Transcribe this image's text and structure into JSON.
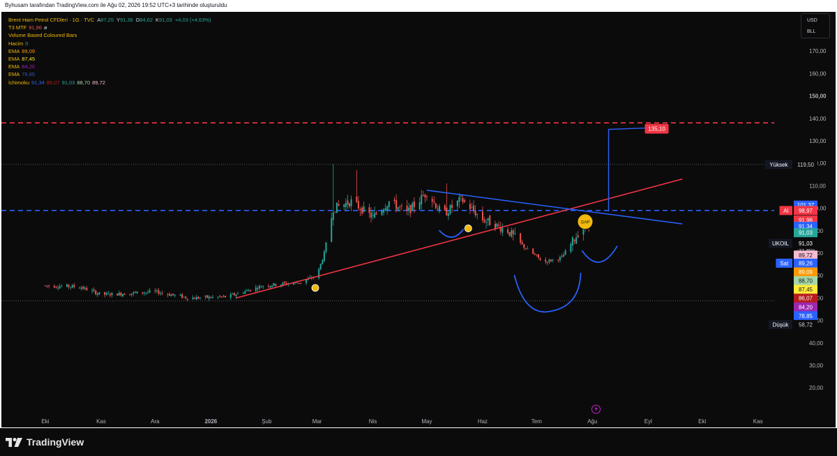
{
  "header": {
    "text": "Byhusam tarafından TradingView.com ile Ağu 02, 2026 19:52 UTC+3 tarihinde oluşturuldu"
  },
  "legend": {
    "title": "Brent Ham Petrol CFDleri · 1G · TVC",
    "ohlc": [
      {
        "key": "A",
        "value": "87,25"
      },
      {
        "key": "Y",
        "value": "91,36"
      },
      {
        "key": "D",
        "value": "84,62"
      },
      {
        "key": "K",
        "value": "91,03"
      }
    ],
    "change": "+4,03 (+4,63%)",
    "indicators": [
      {
        "name": "T3 MTF",
        "values": [
          "91,96",
          "ø"
        ],
        "colors": [
          "#ef5350",
          "#d1d4dc"
        ]
      },
      {
        "name": "Volume Based Coloured Bars",
        "values": [],
        "colors": []
      },
      {
        "name": "Hacim",
        "values": [
          "0"
        ],
        "colors": [
          "#26a69a"
        ]
      },
      {
        "name": "EMA",
        "values": [
          "89,09"
        ],
        "colors": [
          "#ff9800"
        ]
      },
      {
        "name": "EMA",
        "values": [
          "87,45"
        ],
        "colors": [
          "#ffeb3b"
        ]
      },
      {
        "name": "EMA",
        "values": [
          "84,20"
        ],
        "colors": [
          "#9c27b0"
        ]
      },
      {
        "name": "EMA",
        "values": [
          "78,85"
        ],
        "colors": [
          "#3f51b5"
        ]
      },
      {
        "name": "İchimoku",
        "values": [
          "91,34",
          "86,07",
          "91,03",
          "88,70",
          "89,72"
        ],
        "colors": [
          "#2962ff",
          "#b71c1c",
          "#26a69a",
          "#a5d6a7",
          "#f8bbd0"
        ]
      }
    ]
  },
  "currency": {
    "top": "USD",
    "bottom": "BLL"
  },
  "branding": {
    "logo": "TradingView"
  },
  "colors": {
    "background": "#0b0b0b",
    "up": "#26a69a",
    "down": "#ef5350",
    "support": "#f23645",
    "resistance": "#2962ff",
    "pattern": "#2962ff"
  },
  "chart_data": {
    "type": "candlestick",
    "symbol": "UKOIL",
    "timeframe": "1G",
    "y_axis_ticks": [
      20,
      30,
      40,
      50,
      60,
      70,
      80,
      90,
      100,
      110,
      120,
      130,
      140,
      150,
      160,
      170
    ],
    "y_tick_labels": [
      "20,00",
      "30,00",
      "40,00",
      "50,00",
      "60,00",
      "70,00",
      "80,00",
      "90,00",
      "100,00",
      "110,00",
      "120,00",
      "130,00",
      "140,00",
      "150,00",
      "160,00",
      "170,00"
    ],
    "x_tick_labels": [
      "Eki",
      "Kas",
      "Ara",
      "2026",
      "Şub",
      "Mar",
      "Nis",
      "May",
      "Haz",
      "Tem",
      "Ağu",
      "Eyl",
      "Eki",
      "Kas"
    ],
    "bold_ticks": [
      "2026",
      "150,00"
    ],
    "price_path": [
      {
        "date": "2025-10-01",
        "price": 65.5
      },
      {
        "date": "2025-10-20",
        "price": 65.0
      },
      {
        "date": "2025-11-01",
        "price": 61.5
      },
      {
        "date": "2025-11-15",
        "price": 62.0
      },
      {
        "date": "2025-12-01",
        "price": 62.8
      },
      {
        "date": "2025-12-20",
        "price": 60.0
      },
      {
        "date": "2026-01-10",
        "price": 60.5
      },
      {
        "date": "2026-01-30",
        "price": 65.5
      },
      {
        "date": "2026-02-20",
        "price": 67.0
      },
      {
        "date": "2026-03-01",
        "price": 70.0
      },
      {
        "date": "2026-03-05",
        "price": 80.0
      },
      {
        "date": "2026-03-10",
        "price": 100.0
      },
      {
        "date": "2026-03-20",
        "price": 103.0
      },
      {
        "date": "2026-04-01",
        "price": 96.0
      },
      {
        "date": "2026-04-10",
        "price": 103.0
      },
      {
        "date": "2026-04-20",
        "price": 98.0
      },
      {
        "date": "2026-05-01",
        "price": 107.0
      },
      {
        "date": "2026-05-10",
        "price": 97.0
      },
      {
        "date": "2026-05-20",
        "price": 104.0
      },
      {
        "date": "2026-06-01",
        "price": 95.0
      },
      {
        "date": "2026-06-15",
        "price": 90.0
      },
      {
        "date": "2026-06-25",
        "price": 82.0
      },
      {
        "date": "2026-07-05",
        "price": 76.0
      },
      {
        "date": "2026-07-15",
        "price": 78.0
      },
      {
        "date": "2026-07-25",
        "price": 90.0
      },
      {
        "date": "2026-07-30",
        "price": 94.0
      },
      {
        "date": "2026-08-02",
        "price": 91.03
      }
    ],
    "spike_highs": [
      {
        "date": "2026-03-10",
        "price": 119.5
      },
      {
        "date": "2026-03-23",
        "price": 117.0
      },
      {
        "date": "2026-05-12",
        "price": 111.0
      }
    ],
    "horizontal_lines": [
      {
        "label": "138,03",
        "price": 138.03,
        "style": "dashed",
        "color": "#f23645"
      },
      {
        "label": "98,97",
        "price": 98.97,
        "style": "dashed",
        "color": "#2962ff"
      },
      {
        "label": "Yüksek",
        "price": 119.5,
        "style": "dotted",
        "color": "#555a66"
      },
      {
        "label": "Düşük",
        "price": 58.72,
        "style": "dotted",
        "color": "#555a66"
      }
    ],
    "trendlines": [
      {
        "name": "support",
        "color": "#f23645",
        "from": {
          "date": "2026-01-15",
          "price": 60.0
        },
        "to": {
          "date": "2026-09-20",
          "price": 113.0
        }
      },
      {
        "name": "resistance",
        "color": "#2962ff",
        "from": {
          "date": "2026-05-01",
          "price": 108.0
        },
        "to": {
          "date": "2026-09-20",
          "price": 93.0
        }
      }
    ],
    "target": {
      "label": "135,10",
      "price": 135.1,
      "date": "2026-08-10"
    },
    "annotations": [
      {
        "text": "GAP",
        "date": "2026-07-28",
        "price": 94.0
      }
    ],
    "price_labels": [
      {
        "text": "119,50",
        "prefix": "Yüksek",
        "price": 119.5,
        "bg": "#0b0b0b",
        "fg": "#d1d4dc"
      },
      {
        "text": "101,37",
        "price": 101.37,
        "bg": "#2962ff",
        "fg": "#ffffff"
      },
      {
        "text": "98,97",
        "prefix": "Al",
        "price": 98.97,
        "bg": "#f23645",
        "fg": "#ffffff"
      },
      {
        "text": "91,96",
        "price": 94.7,
        "bg": "#f23645",
        "fg": "#ffffff"
      },
      {
        "text": "91,34",
        "price": 91.9,
        "bg": "#2962ff",
        "fg": "#ffffff"
      },
      {
        "text": "91,03",
        "price": 89.1,
        "bg": "#26a69a",
        "fg": "#ffffff"
      },
      {
        "text": "91,03",
        "prefix": "UKOIL",
        "sub": "+37,45%",
        "price": 84.3,
        "bg": "#0b0b0b",
        "fg": "#ffffff"
      },
      {
        "text": "89,72",
        "price": 79.1,
        "bg": "#f8bbd0",
        "fg": "#131722"
      },
      {
        "text": "89,26",
        "prefix": "Sat",
        "price": 75.5,
        "bg": "#2962ff",
        "fg": "#ffffff"
      },
      {
        "text": "89,09",
        "price": 71.6,
        "bg": "#ff9800",
        "fg": "#ffffff"
      },
      {
        "text": "88,70",
        "price": 67.7,
        "bg": "#a5d6a7",
        "fg": "#131722"
      },
      {
        "text": "87,45",
        "price": 63.8,
        "bg": "#ffeb3b",
        "fg": "#131722"
      },
      {
        "text": "86,07",
        "price": 59.9,
        "bg": "#b71c1c",
        "fg": "#ffffff"
      },
      {
        "text": "84,20",
        "price": 56.0,
        "bg": "#9c27b0",
        "fg": "#ffffff"
      },
      {
        "text": "78,85",
        "price": 52.1,
        "bg": "#2962ff",
        "fg": "#ffffff"
      },
      {
        "text": "58,72",
        "prefix": "Düşük",
        "price": 48.2,
        "bg": "#0b0b0b",
        "fg": "#d1d4dc"
      }
    ]
  }
}
